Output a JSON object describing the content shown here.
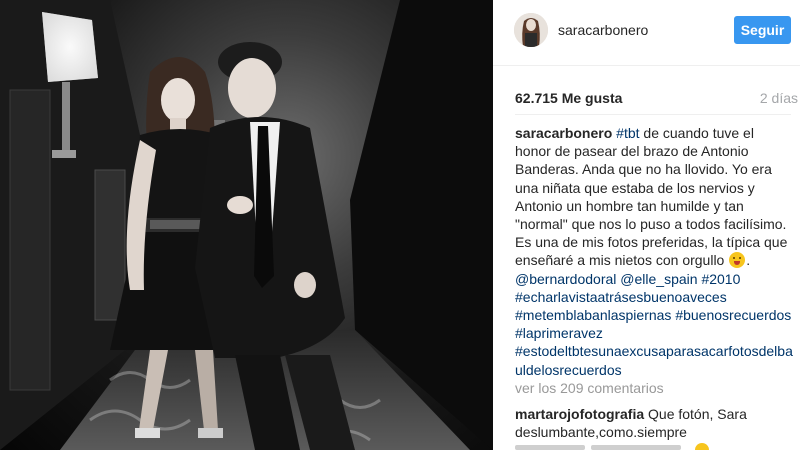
{
  "post": {
    "photo_alt_icon": "post-photo",
    "header": {
      "username": "saracarbonero",
      "follow_label": "Seguir"
    },
    "likes": "62.715 Me gusta",
    "time_ago": "2 días",
    "caption": {
      "username": "saracarbonero",
      "hashtag_tbt": "#tbt",
      "text_1": " de cuando tuve el honor de pasear del brazo de Antonio Banderas. Anda que no ha llovido. Yo era una niñata que estaba de los nervios y Antonio un hombre tan humilde y tan \"normal\" que nos lo puso a todos facilísimo. Es una de mis fotos preferidas, la típica que enseñaré a mis nietos con orgullo ",
      "emoji_name": "tongue-out-emoji",
      "text_2": ". ",
      "mention_1": "@bernardodoral",
      "mention_2": "@elle_spain",
      "hashtags": [
        "#2010",
        "#echarlavistaatrásesbuenoaveces",
        "#metemblabanlaspiernas",
        "#buenosrecuerdos",
        "#laprimeravez",
        "#estodeltbtesunaexcusaparasacarfotosdelbauldelosrecuerdos"
      ]
    },
    "view_comments": "ver los 209 comentarios",
    "comments": [
      {
        "username": "martarojofotografia",
        "text": " Que fotón, Sara deslumbante,como.siempre"
      }
    ],
    "colors": {
      "follow_blue": "#3897f0",
      "link_blue": "#003569",
      "muted_gray": "#999999"
    }
  }
}
